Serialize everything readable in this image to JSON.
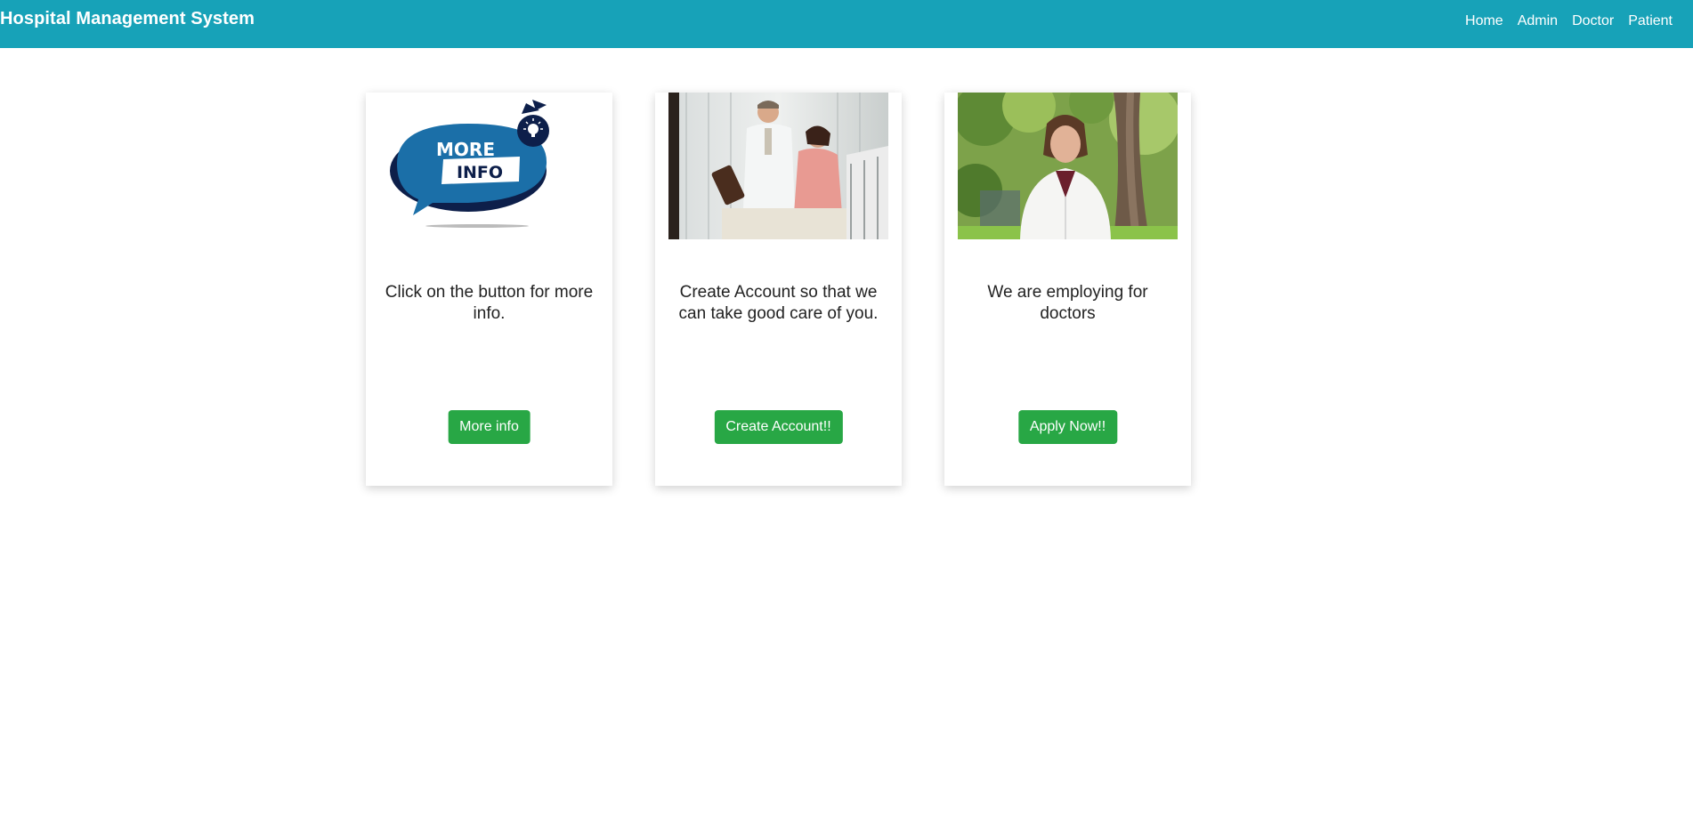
{
  "navbar": {
    "brand": "Hospital Management System",
    "links": [
      "Home",
      "Admin",
      "Doctor",
      "Patient"
    ]
  },
  "cards": [
    {
      "image_label_line1": "MORE",
      "image_label_line2": "INFO",
      "text": "Click on the button for more info.",
      "button": "More info"
    },
    {
      "text": "Create Account so that we can take good care of you.",
      "button": "Create Account!!"
    },
    {
      "text": "We are employing for doctors",
      "button": "Apply Now!!"
    }
  ],
  "colors": {
    "navbar": "#17a2b8",
    "button": "#28a745",
    "info_bubble": "#1b6fa8",
    "info_dark": "#0d1f4a"
  }
}
